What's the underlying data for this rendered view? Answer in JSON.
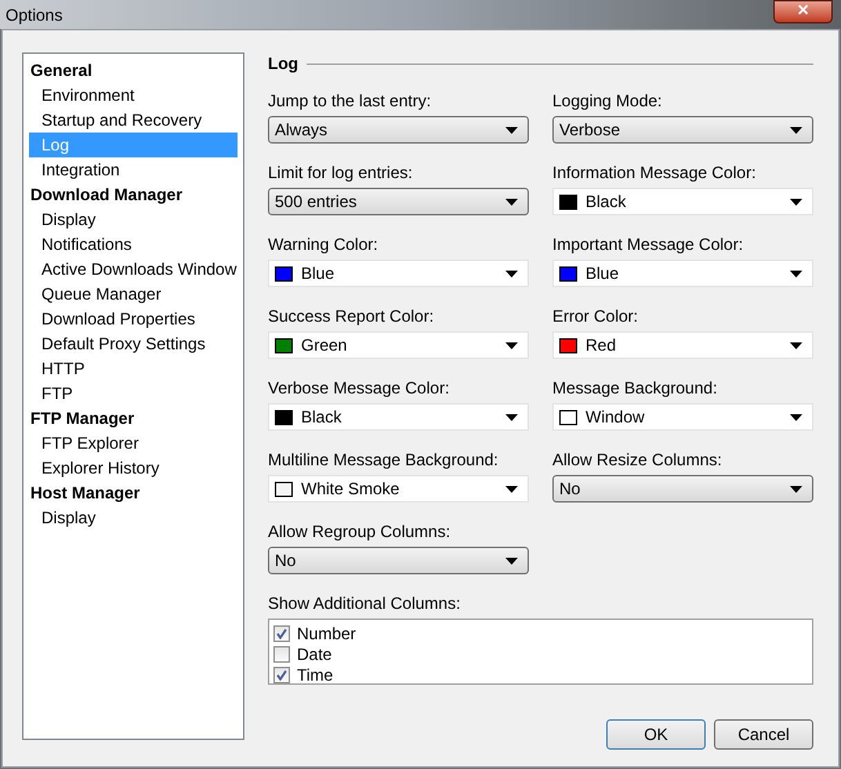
{
  "window": {
    "title": "Options",
    "close": "✕"
  },
  "sidebar": {
    "groups": [
      {
        "label": "General",
        "children": [
          {
            "label": "Environment",
            "selected": false
          },
          {
            "label": "Startup and Recovery",
            "selected": false
          },
          {
            "label": "Log",
            "selected": true
          },
          {
            "label": "Integration",
            "selected": false
          }
        ]
      },
      {
        "label": "Download Manager",
        "children": [
          {
            "label": "Display",
            "selected": false
          },
          {
            "label": "Notifications",
            "selected": false
          },
          {
            "label": "Active Downloads Window",
            "selected": false
          },
          {
            "label": "Queue Manager",
            "selected": false
          },
          {
            "label": "Download Properties",
            "selected": false
          },
          {
            "label": "Default Proxy Settings",
            "selected": false
          },
          {
            "label": "HTTP",
            "selected": false
          },
          {
            "label": "FTP",
            "selected": false
          }
        ]
      },
      {
        "label": "FTP Manager",
        "children": [
          {
            "label": "FTP Explorer",
            "selected": false
          },
          {
            "label": "Explorer History",
            "selected": false
          }
        ]
      },
      {
        "label": "Host Manager",
        "children": [
          {
            "label": "Display",
            "selected": false
          }
        ]
      }
    ]
  },
  "section": {
    "title": "Log"
  },
  "fields": [
    {
      "label": "Jump to the last entry:",
      "kind": "combo",
      "value": "Always"
    },
    {
      "label": "Logging Mode:",
      "kind": "combo",
      "value": "Verbose"
    },
    {
      "label": "Limit for log entries:",
      "kind": "combo",
      "value": "500 entries"
    },
    {
      "label": "Information Message Color:",
      "kind": "color",
      "value": "Black",
      "color": "#000000"
    },
    {
      "label": "Warning Color:",
      "kind": "color",
      "value": "Blue",
      "color": "#0000ff"
    },
    {
      "label": "Important Message Color:",
      "kind": "color",
      "value": "Blue",
      "color": "#0000ff"
    },
    {
      "label": "Success Report Color:",
      "kind": "color",
      "value": "Green",
      "color": "#008000"
    },
    {
      "label": "Error Color:",
      "kind": "color",
      "value": "Red",
      "color": "#ff0000"
    },
    {
      "label": "Verbose Message Color:",
      "kind": "color",
      "value": "Black",
      "color": "#000000"
    },
    {
      "label": "Message Background:",
      "kind": "color",
      "value": "Window",
      "color": "#ffffff"
    },
    {
      "label": "Multiline Message Background:",
      "kind": "color",
      "value": "White Smoke",
      "color": "#f5f5f5"
    },
    {
      "label": "Allow Resize Columns:",
      "kind": "combo",
      "value": "No"
    },
    {
      "label": "Allow Regroup Columns:",
      "kind": "combo",
      "value": "No"
    }
  ],
  "columns": {
    "label": "Show Additional Columns:",
    "items": [
      {
        "label": "Number",
        "checked": true
      },
      {
        "label": "Date",
        "checked": false
      },
      {
        "label": "Time",
        "checked": true
      }
    ]
  },
  "buttons": [
    {
      "label": "OK",
      "default": true
    },
    {
      "label": "Cancel",
      "default": false
    }
  ]
}
